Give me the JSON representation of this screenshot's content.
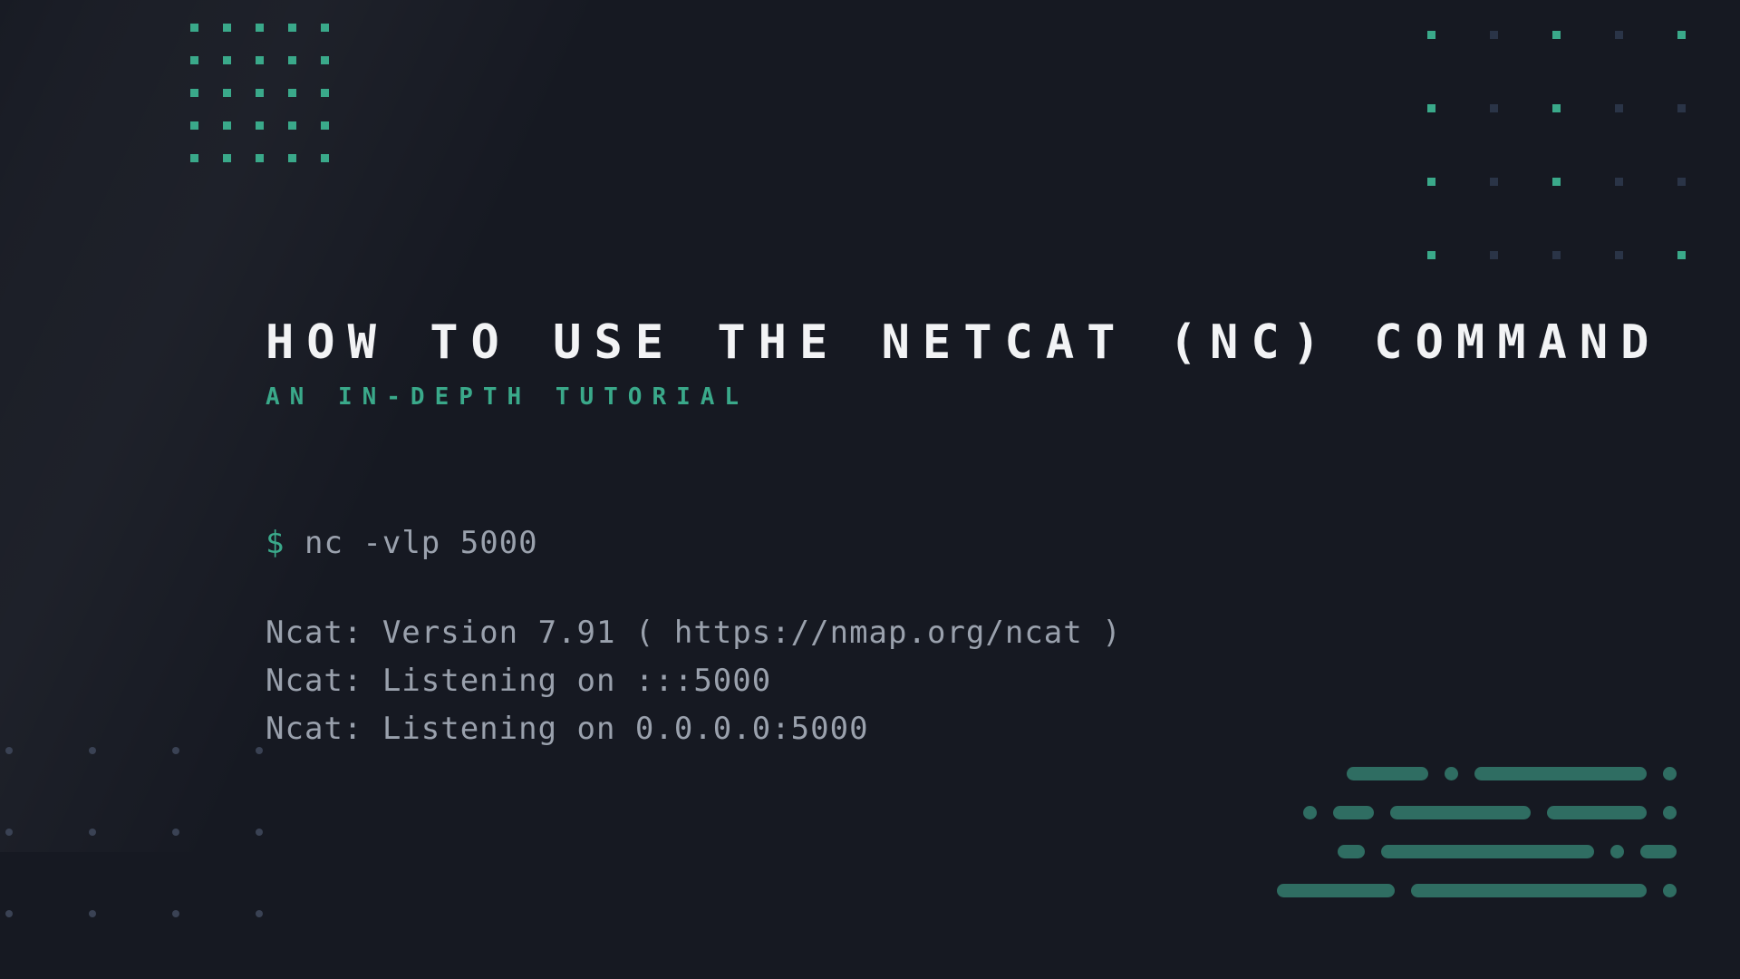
{
  "title": "HOW TO USE THE NETCAT (NC) COMMAND",
  "subtitle": "AN IN-DEPTH TUTORIAL",
  "terminal": {
    "prompt": "$",
    "command": "nc -vlp 5000",
    "output": [
      "Ncat: Version 7.91 ( https://nmap.org/ncat )",
      "Ncat: Listening on :::5000",
      "Ncat: Listening on 0.0.0.0:5000"
    ]
  },
  "colors": {
    "bg": "#161922",
    "accent": "#3aa98a",
    "text_dim": "#9aa1ad"
  }
}
